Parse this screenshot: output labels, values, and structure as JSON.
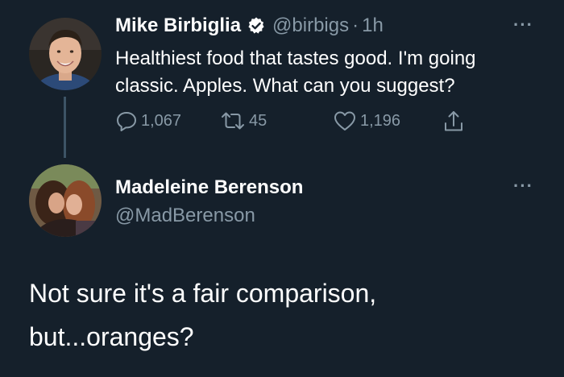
{
  "colors": {
    "background": "#15202b",
    "text_primary": "#ffffff",
    "text_secondary": "#8899a6",
    "thread_line": "#3d5466"
  },
  "tweet": {
    "author_name": "Mike Birbiglia",
    "author_handle": "@birbigs",
    "separator": "·",
    "time": "1h",
    "verified_icon": "verified-badge-icon",
    "more_icon": "more-options-icon",
    "more_label": "···",
    "text_line1": "Healthiest food that tastes good. I'm going",
    "text_line2": "classic. Apples. What can you suggest?",
    "actions": {
      "reply_icon": "reply-icon",
      "reply_count": "1,067",
      "retweet_icon": "retweet-icon",
      "retweet_count": "45",
      "like_icon": "heart-icon",
      "like_count": "1,196",
      "share_icon": "share-icon"
    }
  },
  "reply": {
    "author_name": "Madeleine Berenson",
    "author_handle": "@MadBerenson",
    "more_icon": "more-options-icon",
    "more_label": "···",
    "text_line1": "Not sure it's a fair comparison,",
    "text_line2": "but...oranges?"
  }
}
